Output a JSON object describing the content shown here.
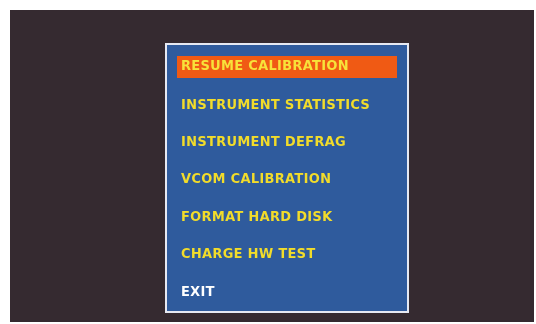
{
  "menu": {
    "items": [
      {
        "label": "RESUME CALIBRATION",
        "selected": true
      },
      {
        "label": "INSTRUMENT STATISTICS",
        "selected": false
      },
      {
        "label": "INSTRUMENT DEFRAG",
        "selected": false
      },
      {
        "label": "VCOM CALIBRATION",
        "selected": false
      },
      {
        "label": "FORMAT HARD DISK",
        "selected": false
      },
      {
        "label": "CHARGE HW TEST",
        "selected": false
      },
      {
        "label": "EXIT",
        "selected": false
      }
    ]
  },
  "colors": {
    "frame_background": "#352a30",
    "panel_background": "#2f5b9d",
    "panel_border": "#e6e9f2",
    "highlight": "#f05a14",
    "item_text": "#f2dc2a",
    "exit_text": "#ffffff"
  }
}
